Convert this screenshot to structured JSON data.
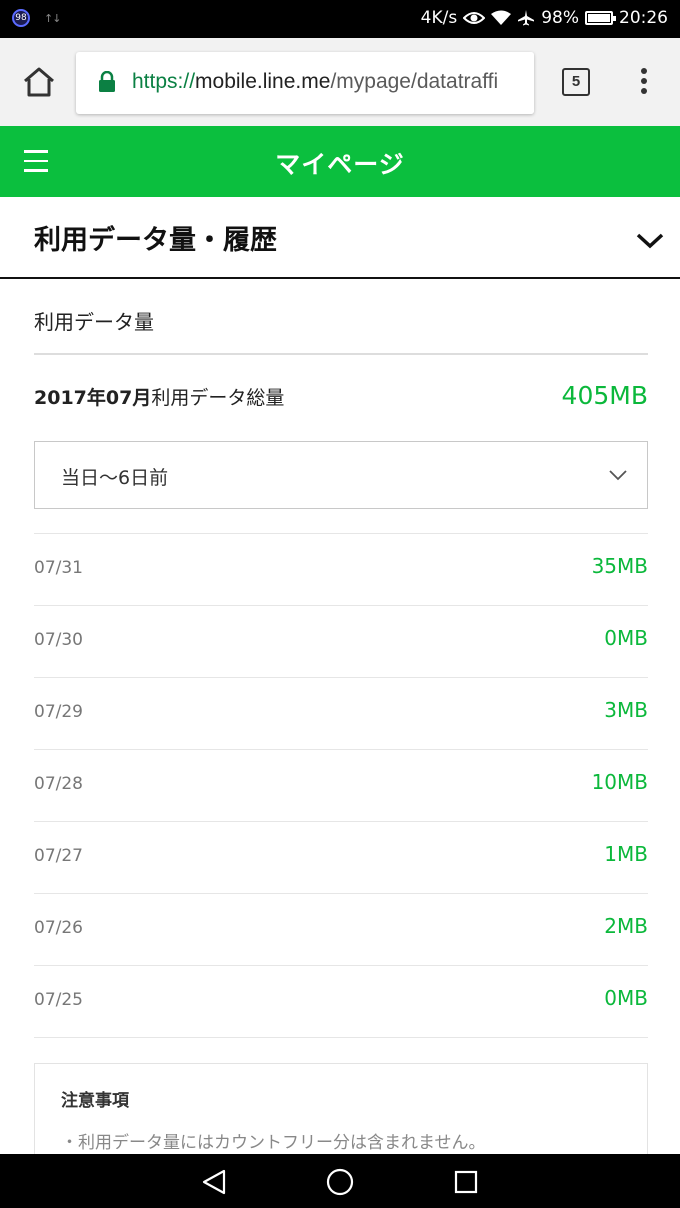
{
  "status_bar": {
    "badge": "98",
    "signal": "↑↓",
    "speed": "4K/s",
    "battery_text": "98%",
    "battery_level": 0.98,
    "time": "20:26"
  },
  "browser": {
    "url_scheme": "https://",
    "url_host": "mobile.line.me",
    "url_path": "/mypage/datatraffi",
    "tab_count": "5"
  },
  "header": {
    "title": "マイページ"
  },
  "section": {
    "title": "利用データ量・履歴"
  },
  "usage": {
    "subtitle": "利用データ量",
    "total_label_bold": "2017年07月",
    "total_label_rest": "利用データ総量",
    "total_value": "405MB",
    "range_select": "当日〜6日前",
    "rows": [
      {
        "date": "07/31",
        "value": "35MB"
      },
      {
        "date": "07/30",
        "value": "0MB"
      },
      {
        "date": "07/29",
        "value": "3MB"
      },
      {
        "date": "07/28",
        "value": "10MB"
      },
      {
        "date": "07/27",
        "value": "1MB"
      },
      {
        "date": "07/26",
        "value": "2MB"
      },
      {
        "date": "07/25",
        "value": "0MB"
      }
    ]
  },
  "notice": {
    "title": "注意事項",
    "item": "・利用データ量にはカウントフリー分は含まれません。"
  },
  "colors": {
    "brand_green": "#0bbf3e",
    "value_green": "#0bb83b"
  }
}
